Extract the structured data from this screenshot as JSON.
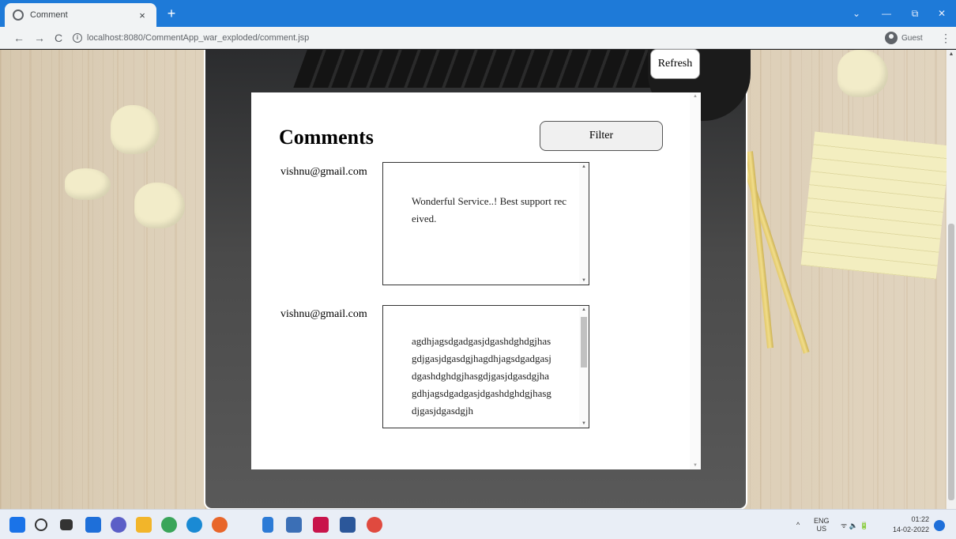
{
  "browser": {
    "tab_title": "Comment",
    "tab_close": "×",
    "new_tab": "+",
    "back": "←",
    "forward": "→",
    "reload": "C",
    "url": "localhost:8080/CommentApp_war_exploded/comment.jsp",
    "profile_label": "Guest",
    "menu": "⋮",
    "window_controls": {
      "minimize": "—",
      "restore": "⧉",
      "close": "✕"
    }
  },
  "page": {
    "refresh_label": "Refresh",
    "heading": "Comments",
    "filter_label": "Filter",
    "comments": [
      {
        "email": "vishnu@gmail.com",
        "text": "Wonderful Service..! Best support received."
      },
      {
        "email": "vishnu@gmail.com",
        "text": "agdhjagsdgadgasjdgashdghdgjhasgdjgasjdgasdgjhagdhjagsdgadgasjdgashdghdgjhasgdjgasjdgasdgjhagdhjagsdgadgasjdgashdghdgjhasgdjgasjdgasdgjh"
      }
    ]
  },
  "taskbar": {
    "lang_top": "ENG",
    "lang_bottom": "US",
    "time": "01:22",
    "date": "14-02-2022",
    "caret": "^",
    "tray_icons": "ᯤ 🔈 🔋"
  },
  "colors": {
    "tab_strip": "#1e7ad8",
    "panel_bg": "#ffffff",
    "button_border": "#555555"
  }
}
